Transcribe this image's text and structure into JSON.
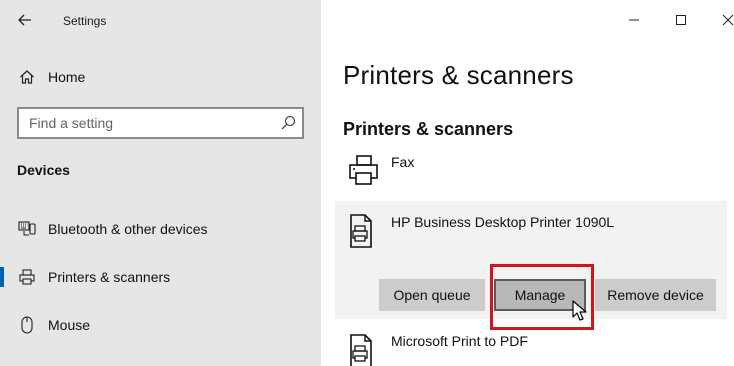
{
  "window": {
    "app_title": "Settings"
  },
  "nav": {
    "home_label": "Home",
    "search_placeholder": "Find a setting",
    "section_label": "Devices",
    "items": [
      {
        "label": "Bluetooth & other devices",
        "icon": "bluetooth-devices-icon"
      },
      {
        "label": "Printers & scanners",
        "icon": "printer-icon",
        "selected": true
      },
      {
        "label": "Mouse",
        "icon": "mouse-icon"
      }
    ]
  },
  "content": {
    "page_title": "Printers & scanners",
    "section_title": "Printers & scanners",
    "devices": [
      {
        "name": "Fax",
        "icon": "fax-icon"
      },
      {
        "name": "HP Business Desktop Printer 1090L",
        "icon": "printer-icon",
        "expanded": true
      },
      {
        "name": "Microsoft Print to PDF",
        "icon": "printer-icon"
      }
    ],
    "actions": {
      "open_queue": "Open queue",
      "manage": "Manage",
      "remove_device": "Remove device"
    }
  },
  "colors": {
    "accent": "#0063b1",
    "highlight": "#d0151e",
    "nav_bg": "#e6e6e6",
    "button_bg": "#cccccc"
  }
}
